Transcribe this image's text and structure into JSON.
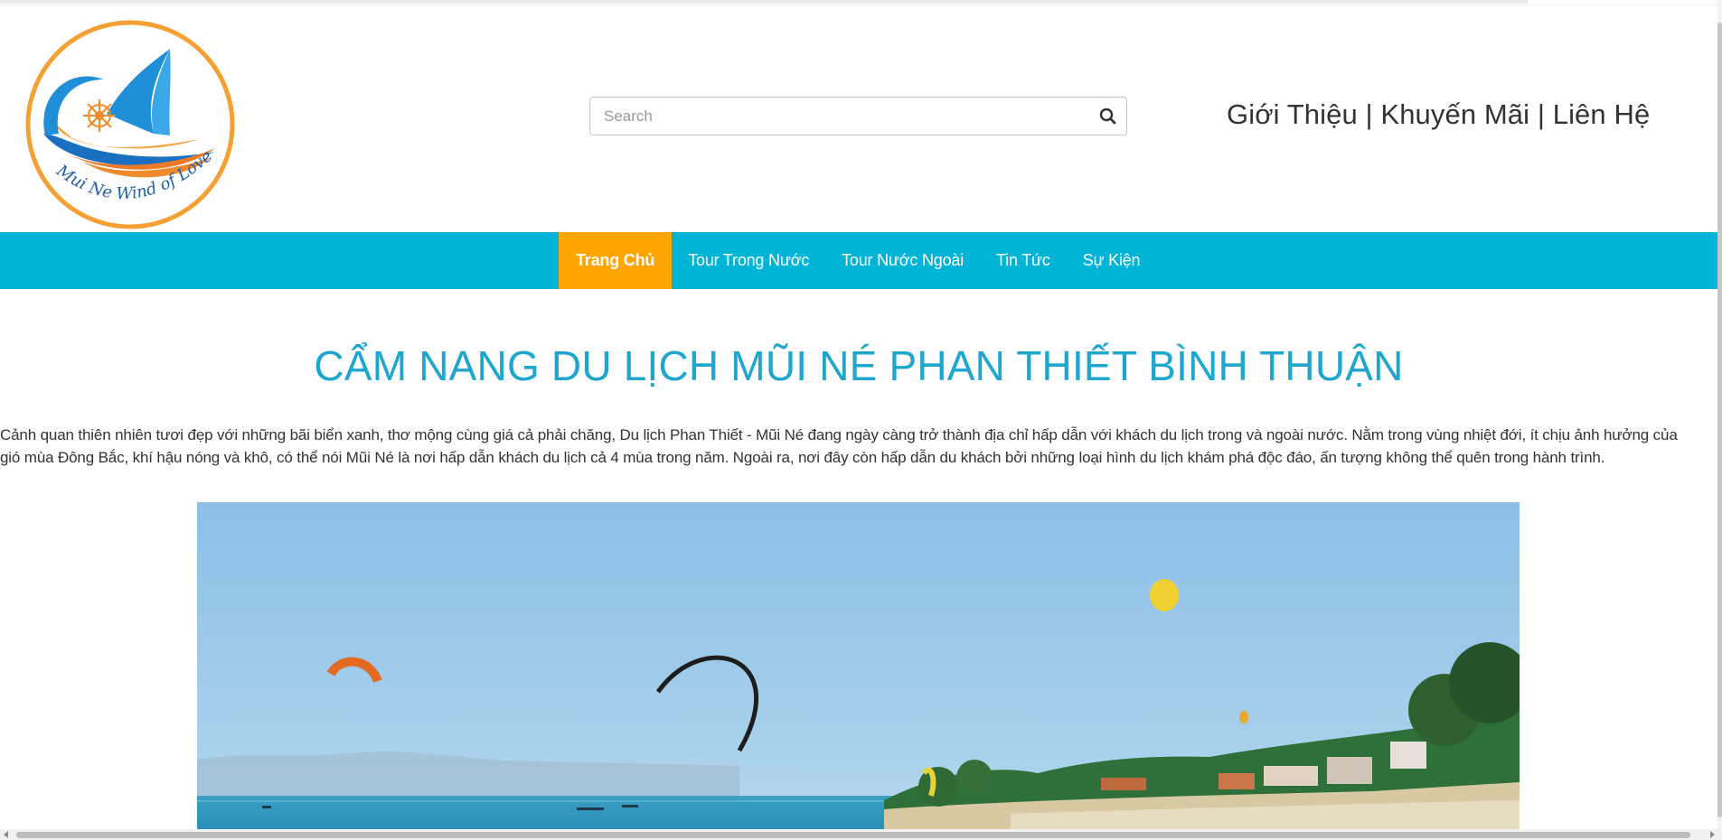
{
  "header": {
    "logo_text": "Mui Ne Wind of Love",
    "search": {
      "placeholder": "Search",
      "value": ""
    },
    "top_links": [
      "Giới Thiệu",
      "Khuyến Mãi",
      "Liên Hệ"
    ],
    "separator": "|"
  },
  "nav": {
    "items": [
      {
        "label": "Trang Chủ",
        "active": true
      },
      {
        "label": "Tour Trong Nước",
        "active": false
      },
      {
        "label": "Tour Nước Ngoài",
        "active": false
      },
      {
        "label": "Tin Tức",
        "active": false
      },
      {
        "label": "Sự Kiện",
        "active": false
      }
    ],
    "bg_color": "#00b4d8",
    "active_color": "#ffa500"
  },
  "main": {
    "title": "CẨM NANG DU LỊCH MŨI NÉ PHAN THIẾT BÌNH THUẬN",
    "intro": "Cảnh quan thiên nhiên tươi đẹp với những bãi biển xanh, thơ mộng cùng giá cả phải chăng, Du lịch Phan Thiết - Mũi Né đang ngày càng trở thành địa chỉ hấp dẫn với khách du lịch trong và ngoài nước. Nằm trong vùng nhiệt đới, ít chịu ảnh hưởng của gió mùa Đông Bắc, khí hậu nóng và khô, có thể nói Mũi Né là nơi hấp dẫn khách du lịch cả 4 mùa trong năm. Ngoài ra, nơi đây còn hấp dẫn du khách bởi những loại hình du lịch khám phá độc đáo, ấn tượng không thể quên trong hành trình.",
    "title_color": "#1fa6cf"
  },
  "icons": {
    "search": "search-icon",
    "logo": "sailboat-logo-icon"
  }
}
